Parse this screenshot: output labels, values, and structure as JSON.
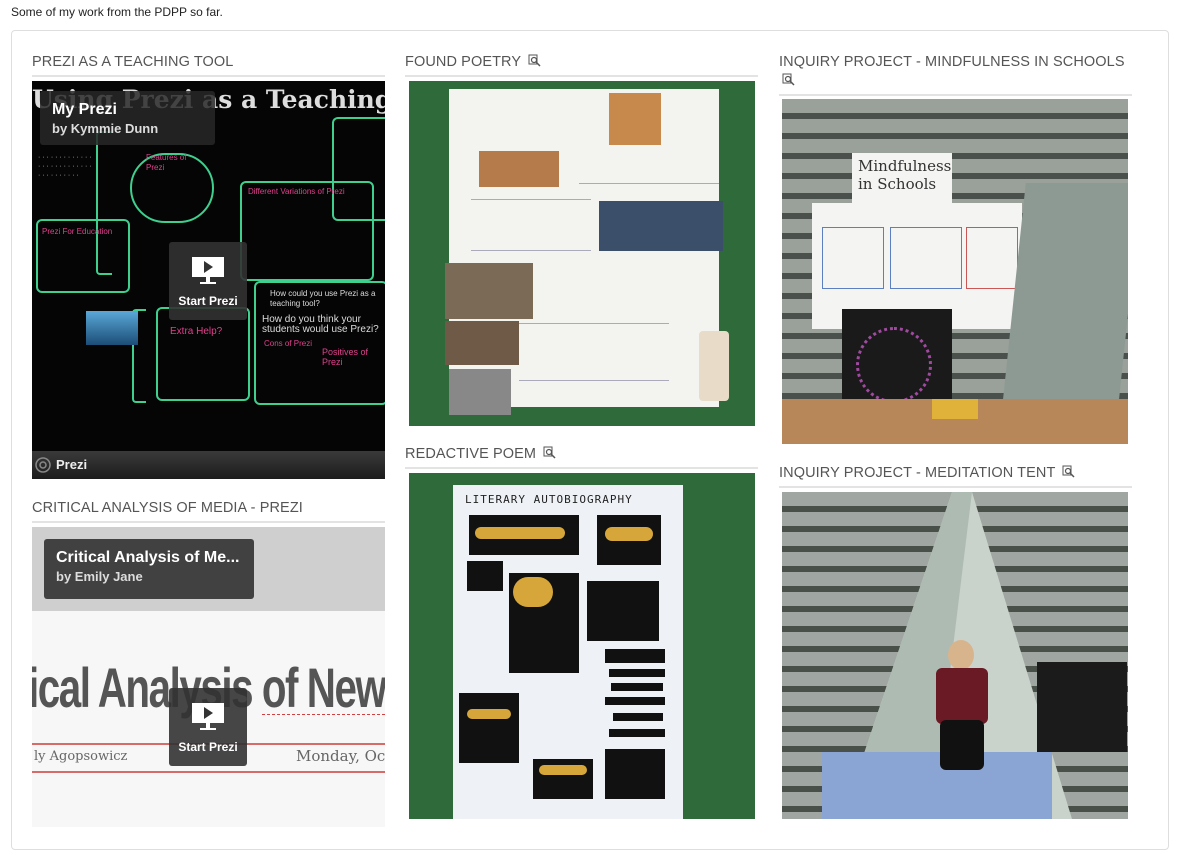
{
  "intro_text": "Some of my work from the PDPP so far.",
  "columns": [
    {
      "items": [
        {
          "title": "PREZI AS A TEACHING TOOL",
          "has_zoom_icon": false,
          "embed": {
            "canvas_heading": "Using Prezi as a Teaching Tool",
            "card_title": "My Prezi",
            "card_author": "by Kymmie Dunn",
            "start_label": "Start Prezi",
            "bar_label": "Prezi",
            "canvas_texts": [
              "Features of Prezi",
              "Prezi For Education",
              "Different Variations of Prezi",
              "Extra Help?",
              "How could you use Prezi as a teaching tool?",
              "How do you think your students would use Prezi?",
              "Cons of Prezi",
              "Positives of Prezi"
            ]
          }
        },
        {
          "title": "CRITICAL ANALYSIS OF MEDIA - PREZI",
          "has_zoom_icon": false,
          "embed": {
            "card_title": "Critical Analysis of Me...",
            "card_author": "by Emily Jane",
            "canvas_heading": "ical Analysis of Newsme",
            "byline": "ly Agopsowicz",
            "date": "Monday, Oc",
            "start_label": "Start Prezi"
          }
        }
      ]
    },
    {
      "items": [
        {
          "title": "FOUND POETRY",
          "has_zoom_icon": true,
          "image_alt": "Found poetry collage on green board"
        },
        {
          "title": "REDACTIVE POEM",
          "has_zoom_icon": true,
          "image_alt": "Literary autobiography redactive poem",
          "poster_heading": "LITERARY AUTOBIOGRAPHY"
        }
      ]
    },
    {
      "items": [
        {
          "title": "INQUIRY PROJECT - MINDFULNESS IN SCHOOLS",
          "has_zoom_icon": true,
          "image_alt": "Mindfulness in Schools display board",
          "board_heading": "Mindfulness in Schools"
        },
        {
          "title": "INQUIRY PROJECT - MEDITATION TENT",
          "has_zoom_icon": true,
          "image_alt": "Person sitting in a meditation tent"
        }
      ]
    }
  ],
  "icons": {
    "zoom": "magnify-icon",
    "play": "play-screen-icon",
    "prezi_logo": "prezi-logo-icon"
  },
  "colors": {
    "title_text": "#555555",
    "neon_green": "#3fcf8e",
    "neon_pink": "#e0408c",
    "board_green": "#2f6b3a"
  }
}
